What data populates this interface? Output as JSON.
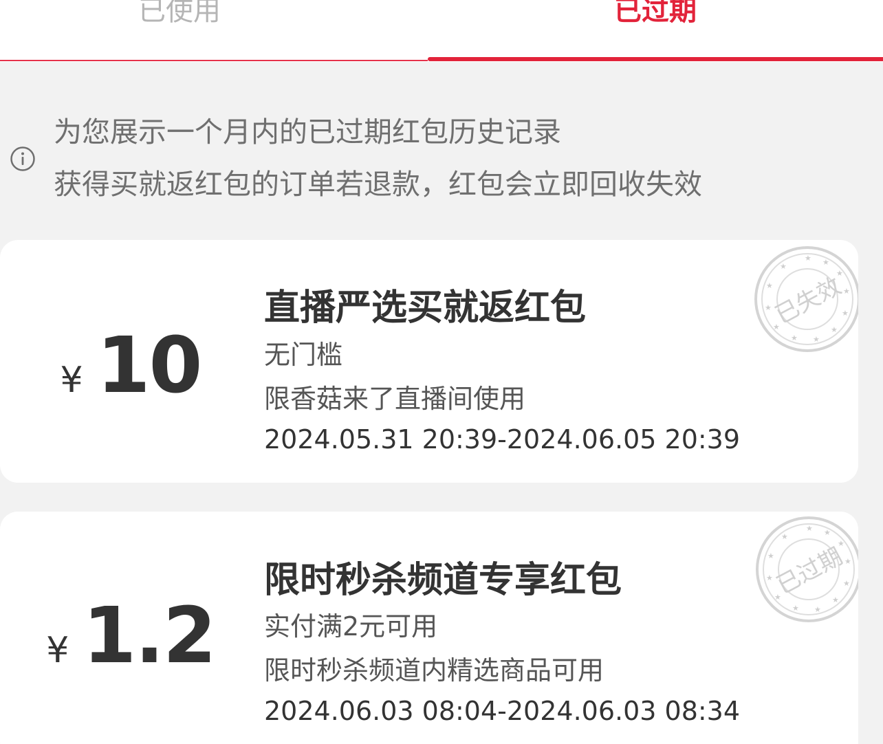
{
  "tabs": {
    "used": "已使用",
    "expired": "已过期",
    "active": "expired",
    "accent_color": "#e2233a"
  },
  "notice": {
    "icon": "info-icon",
    "line1": "为您展示一个月内的已过期红包历史记录",
    "line2": "获得买就返红包的订单若退款，红包会立即回收失效"
  },
  "coupons": [
    {
      "currency": "¥",
      "amount": "10",
      "title": "直播严选买就返红包",
      "threshold": "无门槛",
      "scope": "限香菇来了直播间使用",
      "validity": "2024.05.31 20:39-2024.06.05 20:39",
      "stamp_text": "已失效"
    },
    {
      "currency": "¥",
      "amount": "1.2",
      "title": "限时秒杀频道专享红包",
      "threshold": "实付满2元可用",
      "scope": "限时秒杀频道内精选商品可用",
      "validity": "2024.06.03 08:04-2024.06.03 08:34",
      "stamp_text": "已过期"
    }
  ]
}
